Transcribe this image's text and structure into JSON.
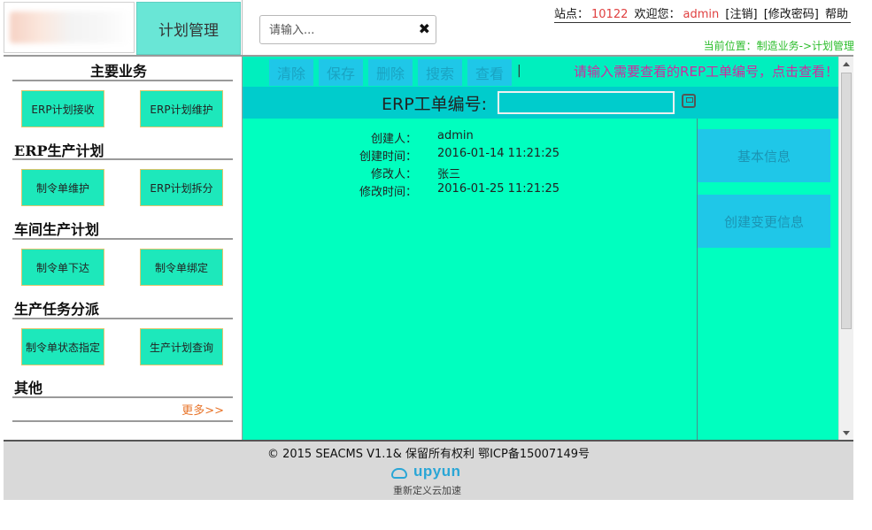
{
  "header": {
    "module_tab": "计划管理",
    "search": {
      "placeholder": "请输入...",
      "clear": "✖"
    },
    "site_label": "站点：",
    "site_id": "10122",
    "welcome_label": "欢迎您：",
    "username": "admin",
    "logout": "[注销]",
    "change_password": "[修改密码]",
    "help": "帮助",
    "location": "当前位置：制造业务->计划管理"
  },
  "sidebar": {
    "sections": [
      {
        "title": "主要业务",
        "buttons": [
          "ERP计划接收",
          "ERP计划维护"
        ]
      },
      {
        "title": "ERP生产计划",
        "buttons": [
          "制令单维护",
          "ERP计划拆分"
        ]
      },
      {
        "title": "车间生产计划",
        "buttons": [
          "制令单下达",
          "制令单绑定"
        ]
      },
      {
        "title": "生产任务分派",
        "buttons": [
          "制令单状态指定",
          "生产计划查询"
        ]
      },
      {
        "title": "其他",
        "buttons": []
      }
    ],
    "more": "更多>>"
  },
  "toolbar": {
    "clear": "清除",
    "save": "保存",
    "delete": "删除",
    "search": "搜索",
    "view": "查看",
    "separator": "|",
    "hint": "请输入需要查看的REP工单编号，点击查看！"
  },
  "erp": {
    "label": "ERP工单编号:",
    "value": ""
  },
  "info": [
    {
      "label": "创建人：",
      "value": "admin"
    },
    {
      "label": "创建时间：",
      "value": "2016-01-14 11:21:25"
    },
    {
      "label": "修改人：",
      "value": "张三"
    },
    {
      "label": "修改时间：",
      "value": "2016-01-25 11:21:25"
    }
  ],
  "right_panel": {
    "basic_info": "基本信息",
    "change_info": "创建变更信息"
  },
  "footer": {
    "copyright": "© 2015 SEACMS V1.1& 保留所有权利 鄂ICP备15007149号",
    "cdn_brand": "upyun",
    "cdn_slogan": "重新定义云加速"
  },
  "colors": {
    "accent": "#00ffbf",
    "button": "#1de8bb",
    "toolbar_button": "#1fc7e8",
    "erp_bar": "#00cccc",
    "link_red": "#e04040",
    "location_green": "#2bbd2b",
    "hint_magenta": "#d02aa0",
    "more_orange": "#e8742a"
  }
}
